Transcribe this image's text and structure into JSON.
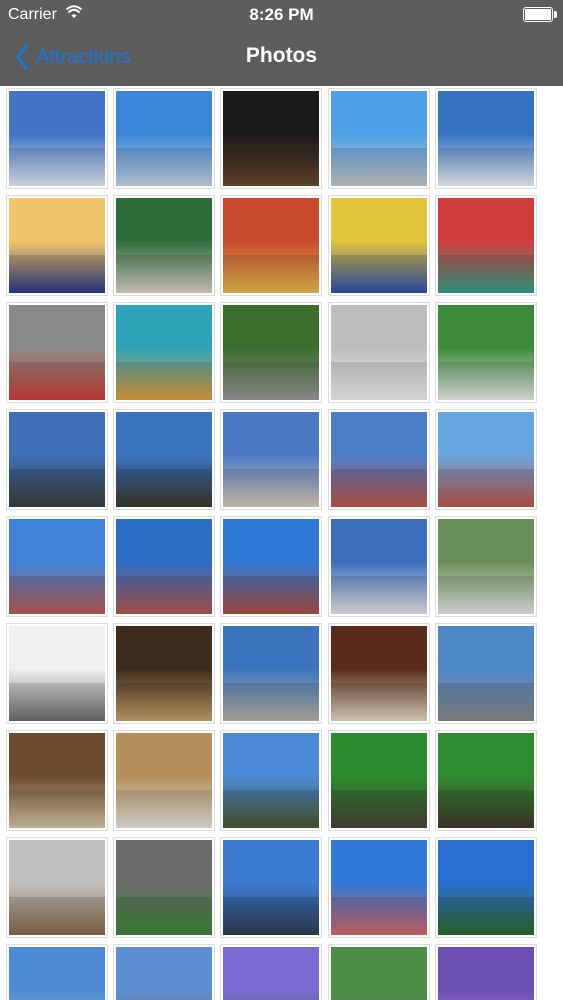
{
  "status": {
    "carrier": "Carrier",
    "time": "8:26 PM"
  },
  "nav": {
    "back_label": "Attractions",
    "title": "Photos"
  },
  "photos": [
    {
      "name": "obelisk-flag",
      "c1": "#3f74c6",
      "c2": "#e7eef9"
    },
    {
      "name": "obelisk-street",
      "c1": "#3a86d8",
      "c2": "#c9d6e4"
    },
    {
      "name": "night-street",
      "c1": "#1a1a1a",
      "c2": "#6b4a2f"
    },
    {
      "name": "obelisk-buildings",
      "c1": "#4da0e6",
      "c2": "#c8c8c8"
    },
    {
      "name": "obelisk-sky",
      "c1": "#3572c4",
      "c2": "#f0f2f5"
    },
    {
      "name": "obelisk-sunset",
      "c1": "#f3c56b",
      "c2": "#2b3a8a"
    },
    {
      "name": "market-umbrellas",
      "c1": "#2e6c3b",
      "c2": "#dcd6cc"
    },
    {
      "name": "caminito-houses",
      "c1": "#c8492e",
      "c2": "#e7bd4e"
    },
    {
      "name": "colorful-buildings",
      "c1": "#e2c53b",
      "c2": "#2a51b3"
    },
    {
      "name": "la-boca-colors",
      "c1": "#cf3d3d",
      "c2": "#35a28a"
    },
    {
      "name": "market-square",
      "c1": "#8a8a8a",
      "c2": "#d2413a"
    },
    {
      "name": "colorful-houses",
      "c1": "#2ea3b8",
      "c2": "#e6a03c"
    },
    {
      "name": "motorbike-street",
      "c1": "#3b6d2d",
      "c2": "#9b9b9b"
    },
    {
      "name": "building-street",
      "c1": "#bdbdbd",
      "c2": "#f1f1f1"
    },
    {
      "name": "park-trees",
      "c1": "#3c8b3a",
      "c2": "#ececec"
    },
    {
      "name": "statue-arm-1",
      "c1": "#3c6fb6",
      "c2": "#3b3f37"
    },
    {
      "name": "statue-arm-2",
      "c1": "#3a72bf",
      "c2": "#3a3a2c"
    },
    {
      "name": "palace-front",
      "c1": "#4b79c4",
      "c2": "#d7cdbd"
    },
    {
      "name": "pink-house",
      "c1": "#4a7ec9",
      "c2": "#c05648"
    },
    {
      "name": "pink-house-statue",
      "c1": "#69a6e0",
      "c2": "#c1584b"
    },
    {
      "name": "plaza-de-mayo",
      "c1": "#3f82d8",
      "c2": "#bf5d56"
    },
    {
      "name": "fountain",
      "c1": "#2b6cc4",
      "c2": "#b85a52"
    },
    {
      "name": "equestrian-statue",
      "c1": "#2e78d6",
      "c2": "#b05045"
    },
    {
      "name": "white-church",
      "c1": "#3c6fbb",
      "c2": "#e8e8e8"
    },
    {
      "name": "cathedral-trees",
      "c1": "#6b8f58",
      "c2": "#e9e9e9"
    },
    {
      "name": "columns",
      "c1": "#f0f0f0",
      "c2": "#6d6d6d"
    },
    {
      "name": "church-interior",
      "c1": "#3d2b1d",
      "c2": "#c9a46c"
    },
    {
      "name": "cathedral-facade",
      "c1": "#3b74bd",
      "c2": "#b9b4a8"
    },
    {
      "name": "dome-interior",
      "c1": "#5a2a1a",
      "c2": "#e7ddc6"
    },
    {
      "name": "cathedral-crowd",
      "c1": "#4e88c7",
      "c2": "#8a8a8a"
    },
    {
      "name": "church-dome-interior",
      "c1": "#6b4a2f",
      "c2": "#d8c9a8"
    },
    {
      "name": "bell-tower",
      "c1": "#b38f5a",
      "c2": "#e9e7df"
    },
    {
      "name": "grassland",
      "c1": "#4a8ad6",
      "c2": "#4a5a2e"
    },
    {
      "name": "capybara-1",
      "c1": "#2b8a2b",
      "c2": "#4b4438"
    },
    {
      "name": "capybara-2",
      "c1": "#2f8b2f",
      "c2": "#433a2f"
    },
    {
      "name": "shoreline",
      "c1": "#c0c0c0",
      "c2": "#8a6b4a"
    },
    {
      "name": "garden-entrance",
      "c1": "#6b6b6b",
      "c2": "#3f8a3a"
    },
    {
      "name": "statue-silhouette",
      "c1": "#3b7bd2",
      "c2": "#2f3f52"
    },
    {
      "name": "casa-rosada",
      "c1": "#2f78d6",
      "c2": "#d66a6a"
    },
    {
      "name": "palm-plaza",
      "c1": "#2a6fd0",
      "c2": "#2f6b2f"
    },
    {
      "name": "building-row",
      "c1": "#4b8bd6",
      "c2": "#b5b5b5"
    },
    {
      "name": "statue-buildings",
      "c1": "#5c8fd3",
      "c2": "#7a6a55"
    },
    {
      "name": "jacaranda",
      "c1": "#7b6ad3",
      "c2": "#4d6b3c"
    },
    {
      "name": "crowd-trees",
      "c1": "#4a8f44",
      "c2": "#6b6b6b"
    },
    {
      "name": "flower-crowd",
      "c1": "#6b4fb5",
      "c2": "#b38fd3"
    }
  ]
}
